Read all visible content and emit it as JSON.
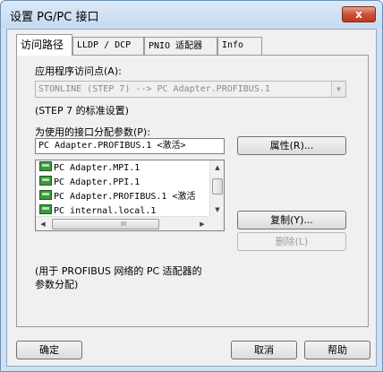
{
  "window": {
    "title": "设置 PG/PC 接口",
    "close_glyph": "x"
  },
  "tabs": [
    {
      "label": "访问路径",
      "active": true
    },
    {
      "label": "LLDP / DCP",
      "active": false
    },
    {
      "label": "PNIO 适配器",
      "active": false
    },
    {
      "label": "Info",
      "active": false
    }
  ],
  "access_point": {
    "label": "应用程序访问点(A):",
    "value": "STONLINE (STEP 7)      --> PC Adapter.PROFIBUS.1",
    "arrow_glyph": "▼",
    "hint": "(STEP 7 的标准设置)"
  },
  "interface": {
    "label": "为使用的接口分配参数(P):",
    "assigned": "PC Adapter.PROFIBUS.1  <激活>",
    "items": [
      "PC Adapter.MPI.1",
      "PC Adapter.PPI.1",
      "PC Adapter.PROFIBUS.1  <激活",
      "PC internal.local.1"
    ],
    "description": [
      "(用于 PROFIBUS 网络的 PC 适配器的",
      "参数分配)"
    ]
  },
  "scrollbars": {
    "up": "▲",
    "down": "▼",
    "left": "◀",
    "right": "▶",
    "grip": "III"
  },
  "buttons": {
    "properties": "属性(R)...",
    "copy": "复制(Y)...",
    "delete": "删除(L)",
    "ok": "确定",
    "cancel": "取消",
    "help": "帮助"
  },
  "colors": {
    "title_bar": "#c6dbf1",
    "close_button": "#c8513a",
    "dialog_background": "#f0f0f0",
    "adapter_icon": "#3a9a3a"
  }
}
